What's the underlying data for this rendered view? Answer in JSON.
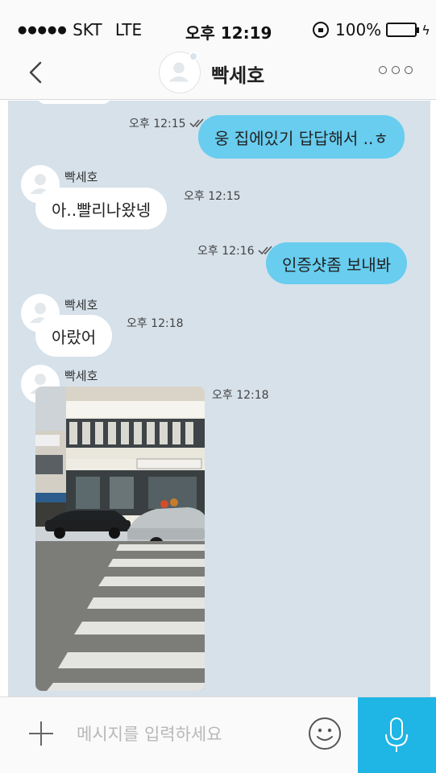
{
  "status_bar": {
    "signal_dots": "●●●●●",
    "carrier": "SKT",
    "network": "LTE",
    "time": "오후 12:19",
    "battery": "100%",
    "battery_color": "#4cd964"
  },
  "header": {
    "back_icon": "chevron-left",
    "contact_name": "빡세호",
    "more_icon": "three-dots"
  },
  "messages": [
    {
      "direction": "out",
      "time": "오후 12:15",
      "read": true,
      "text": "웅 집에있기 답답해서 ..ㅎ"
    },
    {
      "direction": "in",
      "sender": "빡세호",
      "time": "오후 12:15",
      "text": "아..빨리나왔넹"
    },
    {
      "direction": "out",
      "time": "오후 12:16",
      "read": true,
      "text": "인증샷좀 보내봐"
    },
    {
      "direction": "in",
      "sender": "빡세호",
      "time": "오후 12:18",
      "text": "아랐어"
    },
    {
      "direction": "in",
      "sender": "빡세호",
      "time": "오후 12:18",
      "type": "photo"
    }
  ],
  "input_bar": {
    "placeholder": "메시지를 입력하세요",
    "plus_icon": "plus",
    "emoji_icon": "smiley",
    "mic_icon": "microphone"
  },
  "colors": {
    "chat_background": "#d6e1ea",
    "outgoing_bubble": "#68cdef",
    "incoming_bubble": "#ffffff",
    "mic_button": "#1fb5e5"
  }
}
